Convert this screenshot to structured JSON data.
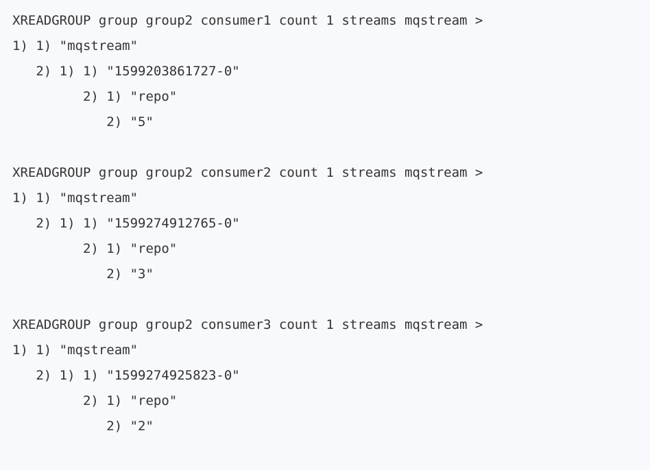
{
  "code_block": {
    "lines": [
      "XREADGROUP group group2 consumer1 count 1 streams mqstream >",
      "1) 1) \"mqstream\"",
      "   2) 1) 1) \"1599203861727-0\"",
      "         2) 1) \"repo\"",
      "            2) \"5\"",
      "",
      "XREADGROUP group group2 consumer2 count 1 streams mqstream >",
      "1) 1) \"mqstream\"",
      "   2) 1) 1) \"1599274912765-0\"",
      "         2) 1) \"repo\"",
      "            2) \"3\"",
      "",
      "XREADGROUP group group2 consumer3 count 1 streams mqstream >",
      "1) 1) \"mqstream\"",
      "   2) 1) 1) \"1599274925823-0\"",
      "         2) 1) \"repo\"",
      "            2) \"2\""
    ]
  }
}
